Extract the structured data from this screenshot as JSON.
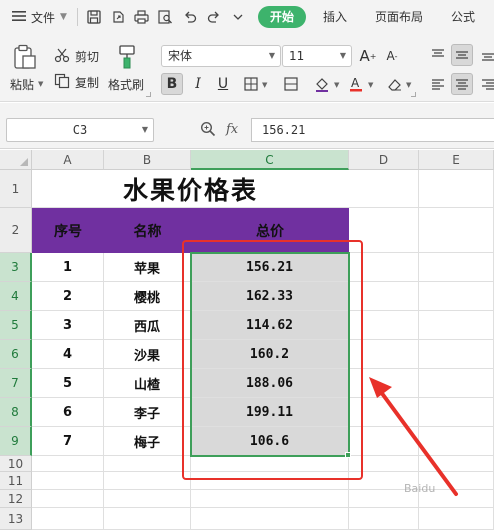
{
  "menu": {
    "file_label": "文件",
    "tabs": [
      {
        "label": "开始",
        "active": true
      },
      {
        "label": "插入",
        "active": false
      },
      {
        "label": "页面布局",
        "active": false
      },
      {
        "label": "公式",
        "active": false
      }
    ]
  },
  "ribbon": {
    "paste_label": "粘贴",
    "cut_label": "剪切",
    "copy_label": "复制",
    "format_painter_label": "格式刷",
    "font_name": "宋体",
    "font_size": "11"
  },
  "formula_bar": {
    "cell_ref": "C3",
    "fx_label": "fx",
    "value": "156.21"
  },
  "columns": [
    "A",
    "B",
    "C",
    "D",
    "E"
  ],
  "selected_column": "C",
  "rows": [
    "1",
    "2",
    "3",
    "4",
    "5",
    "6",
    "7",
    "8",
    "9",
    "10",
    "11",
    "12",
    "13"
  ],
  "selected_rows": [
    "3",
    "4",
    "5",
    "6",
    "7",
    "8",
    "9"
  ],
  "sheet": {
    "title": "水果价格表",
    "headers": [
      "序号",
      "名称",
      "总价"
    ],
    "records": [
      {
        "no": "1",
        "name": "苹果",
        "price": "156.21"
      },
      {
        "no": "2",
        "name": "樱桃",
        "price": "162.33"
      },
      {
        "no": "3",
        "name": "西瓜",
        "price": "114.62"
      },
      {
        "no": "4",
        "name": "沙果",
        "price": "160.2"
      },
      {
        "no": "5",
        "name": "山楂",
        "price": "188.06"
      },
      {
        "no": "6",
        "name": "李子",
        "price": "199.11"
      },
      {
        "no": "7",
        "name": "梅子",
        "price": "106.6"
      }
    ]
  },
  "colors": {
    "accent": "#3db36c",
    "header_fill": "#7030a0",
    "selection": "#3e9f5a",
    "annotation": "#e8312a",
    "price_fill": "#d9d9d9"
  },
  "watermark": "Baidu"
}
